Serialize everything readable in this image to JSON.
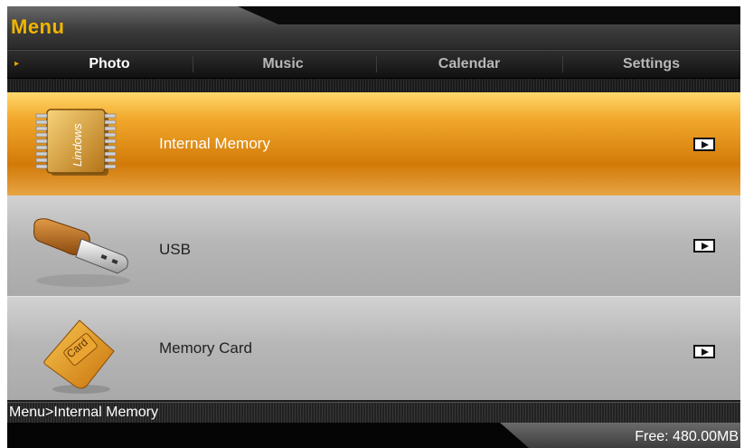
{
  "header": {
    "title": "Menu"
  },
  "tabs": [
    {
      "label": "Photo",
      "active": true
    },
    {
      "label": "Music",
      "active": false
    },
    {
      "label": "Calendar",
      "active": false
    },
    {
      "label": "Settings",
      "active": false
    }
  ],
  "sources": [
    {
      "label": "Internal Memory",
      "icon": "book-icon",
      "selected": true
    },
    {
      "label": "USB",
      "icon": "usb-drive-icon",
      "selected": false
    },
    {
      "label": "Memory Card",
      "icon": "memory-card-icon",
      "selected": false
    }
  ],
  "icon_text": {
    "book": "Lindows",
    "card": "Card"
  },
  "status": {
    "breadcrumb": "Menu>Internal Memory",
    "free_space": "Free: 480.00MB"
  },
  "colors": {
    "accent": "#f1b500",
    "selected_row": "#e08a12"
  }
}
